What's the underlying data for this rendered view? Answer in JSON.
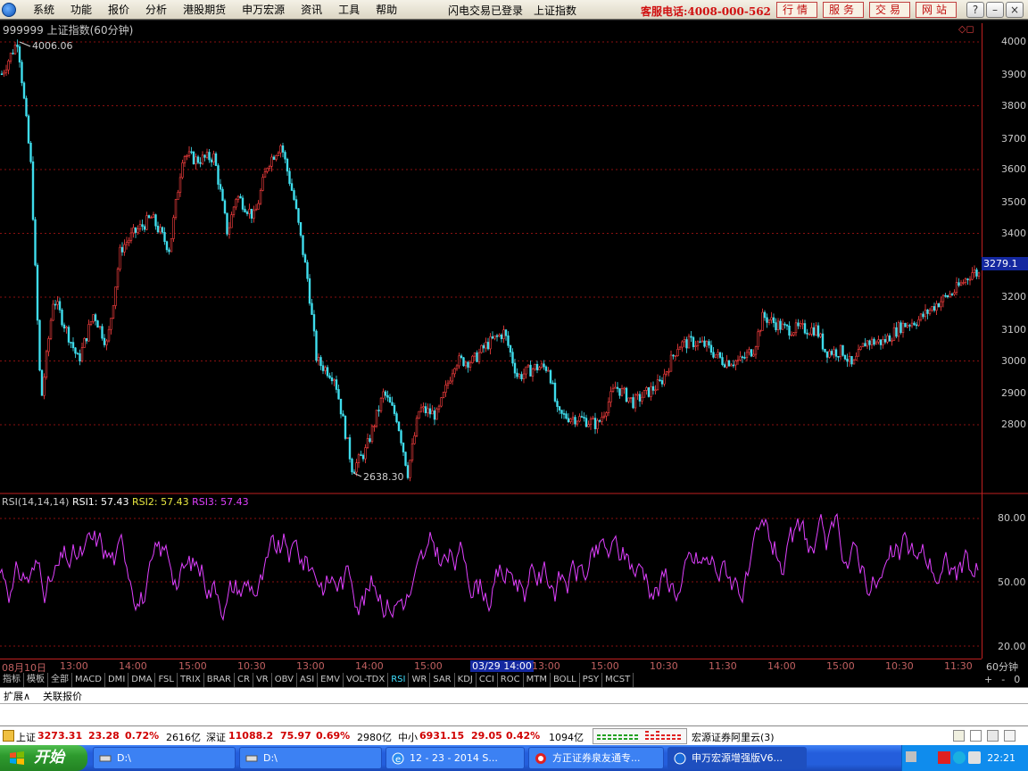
{
  "menu": {
    "items": [
      "系统",
      "功能",
      "报价",
      "分析",
      "港股期货",
      "申万宏源",
      "资讯",
      "工具",
      "帮助"
    ],
    "status": "闪电交易已登录",
    "market": "上证指数",
    "hotline": "客服电话:4008-000-562",
    "nav_buttons": [
      "行情",
      "服务",
      "交易",
      "网站"
    ]
  },
  "chart": {
    "title": "999999 上证指数(60分钟)",
    "high_label": "4006.06",
    "low_label": "2638.30",
    "last_price": "3279.1",
    "price_ticks": [
      "4000",
      "3900",
      "3800",
      "3700",
      "3600",
      "3500",
      "3400",
      "3200",
      "3100",
      "3000",
      "2900",
      "2800"
    ],
    "rsi": {
      "prefix": "RSI(14,14,14)",
      "rsi1": "RSI1: 57.43",
      "rsi2": "RSI2: 57.43",
      "rsi3": "RSI3: 57.43",
      "ticks": [
        "80.00",
        "50.00",
        "20.00"
      ]
    },
    "time_labels": [
      "08月10日",
      "13:00",
      "14:00",
      "15:00",
      "10:30",
      "13:00",
      "14:00",
      "15:00",
      "03/29 14:00",
      "13:00",
      "15:00",
      "10:30",
      "11:30",
      "14:00",
      "15:00",
      "10:30",
      "11:30"
    ],
    "period": "60分钟",
    "colors": {
      "up": "#ff4040",
      "down": "#40e0f0",
      "rsi": "#e040ff",
      "grid": "#8a1010"
    }
  },
  "indicator_tabs": [
    "指标",
    "模板",
    "全部",
    "MACD",
    "DMI",
    "DMA",
    "FSL",
    "TRIX",
    "BRAR",
    "CR",
    "VR",
    "OBV",
    "ASI",
    "EMV",
    "VOL-TDX",
    "RSI",
    "WR",
    "SAR",
    "KDJ",
    "CCI",
    "ROC",
    "MTM",
    "BOLL",
    "PSY",
    "MCST"
  ],
  "active_tab": "RSI",
  "zoom": [
    "+",
    "-",
    "0"
  ],
  "extension": [
    "扩展∧",
    "关联报价"
  ],
  "status": {
    "sh_name": "上证",
    "sh_value": "3273.31",
    "sh_change": "23.28",
    "sh_pct": "0.72%",
    "sh_amount": "2616亿",
    "sz_name": "深证",
    "sz_value": "11088.2",
    "sz_change": "75.97",
    "sz_pct": "0.69%",
    "sz_amount": "2980亿",
    "zx_name": "中小",
    "zx_value": "6931.15",
    "zx_change": "29.05",
    "zx_pct": "0.42%",
    "zx_amount": "1094亿",
    "server": "宏源证券阿里云(3)"
  },
  "taskbar": {
    "start": "开始",
    "tasks": [
      "D:\\",
      "D:\\",
      "12 - 23 - 2014 S...",
      "方正证券泉友通专...",
      "申万宏源增强版V6..."
    ],
    "clock": "22:21"
  }
}
